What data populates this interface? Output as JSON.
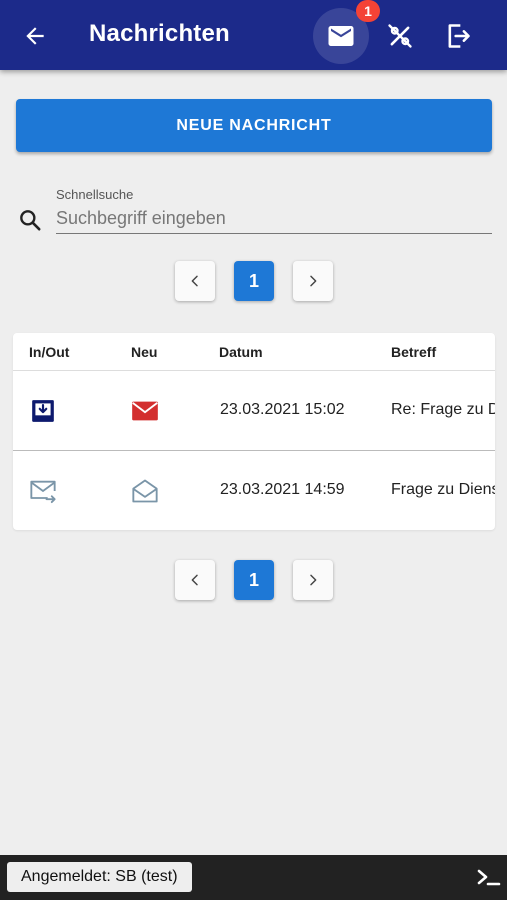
{
  "appbar": {
    "title": "Nachrichten",
    "badge_count": "1",
    "icons": [
      "arrow-back-icon",
      "mail-icon",
      "percent-slash-icon",
      "logout-icon"
    ]
  },
  "actions": {
    "new_message_label": "NEUE NACHRICHT"
  },
  "search": {
    "label": "Schnellsuche",
    "placeholder": "Suchbegriff eingeben",
    "value": ""
  },
  "pagination": {
    "current_page": "1"
  },
  "table": {
    "columns": [
      "In/Out",
      "Neu",
      "Datum",
      "Betreff"
    ],
    "rows": [
      {
        "direction_icon": "inbox-incoming-icon",
        "new_icon": "mail-unread-icon",
        "date": "23.03.2021 15:02",
        "subject": "Re: Frage zu Dienstleistung"
      },
      {
        "direction_icon": "mail-outgoing-icon",
        "new_icon": "mail-open-icon",
        "date": "23.03.2021 14:59",
        "subject": "Frage zu Dienstleistung"
      }
    ]
  },
  "colors": {
    "appbar": "#1c2a8a",
    "primary": "#1e78d6",
    "badge": "#f44336",
    "unread": "#d32f2f",
    "muted_icon": "#7a95a8"
  },
  "status": {
    "logged_in": "Angemeldet: SB (test)"
  }
}
